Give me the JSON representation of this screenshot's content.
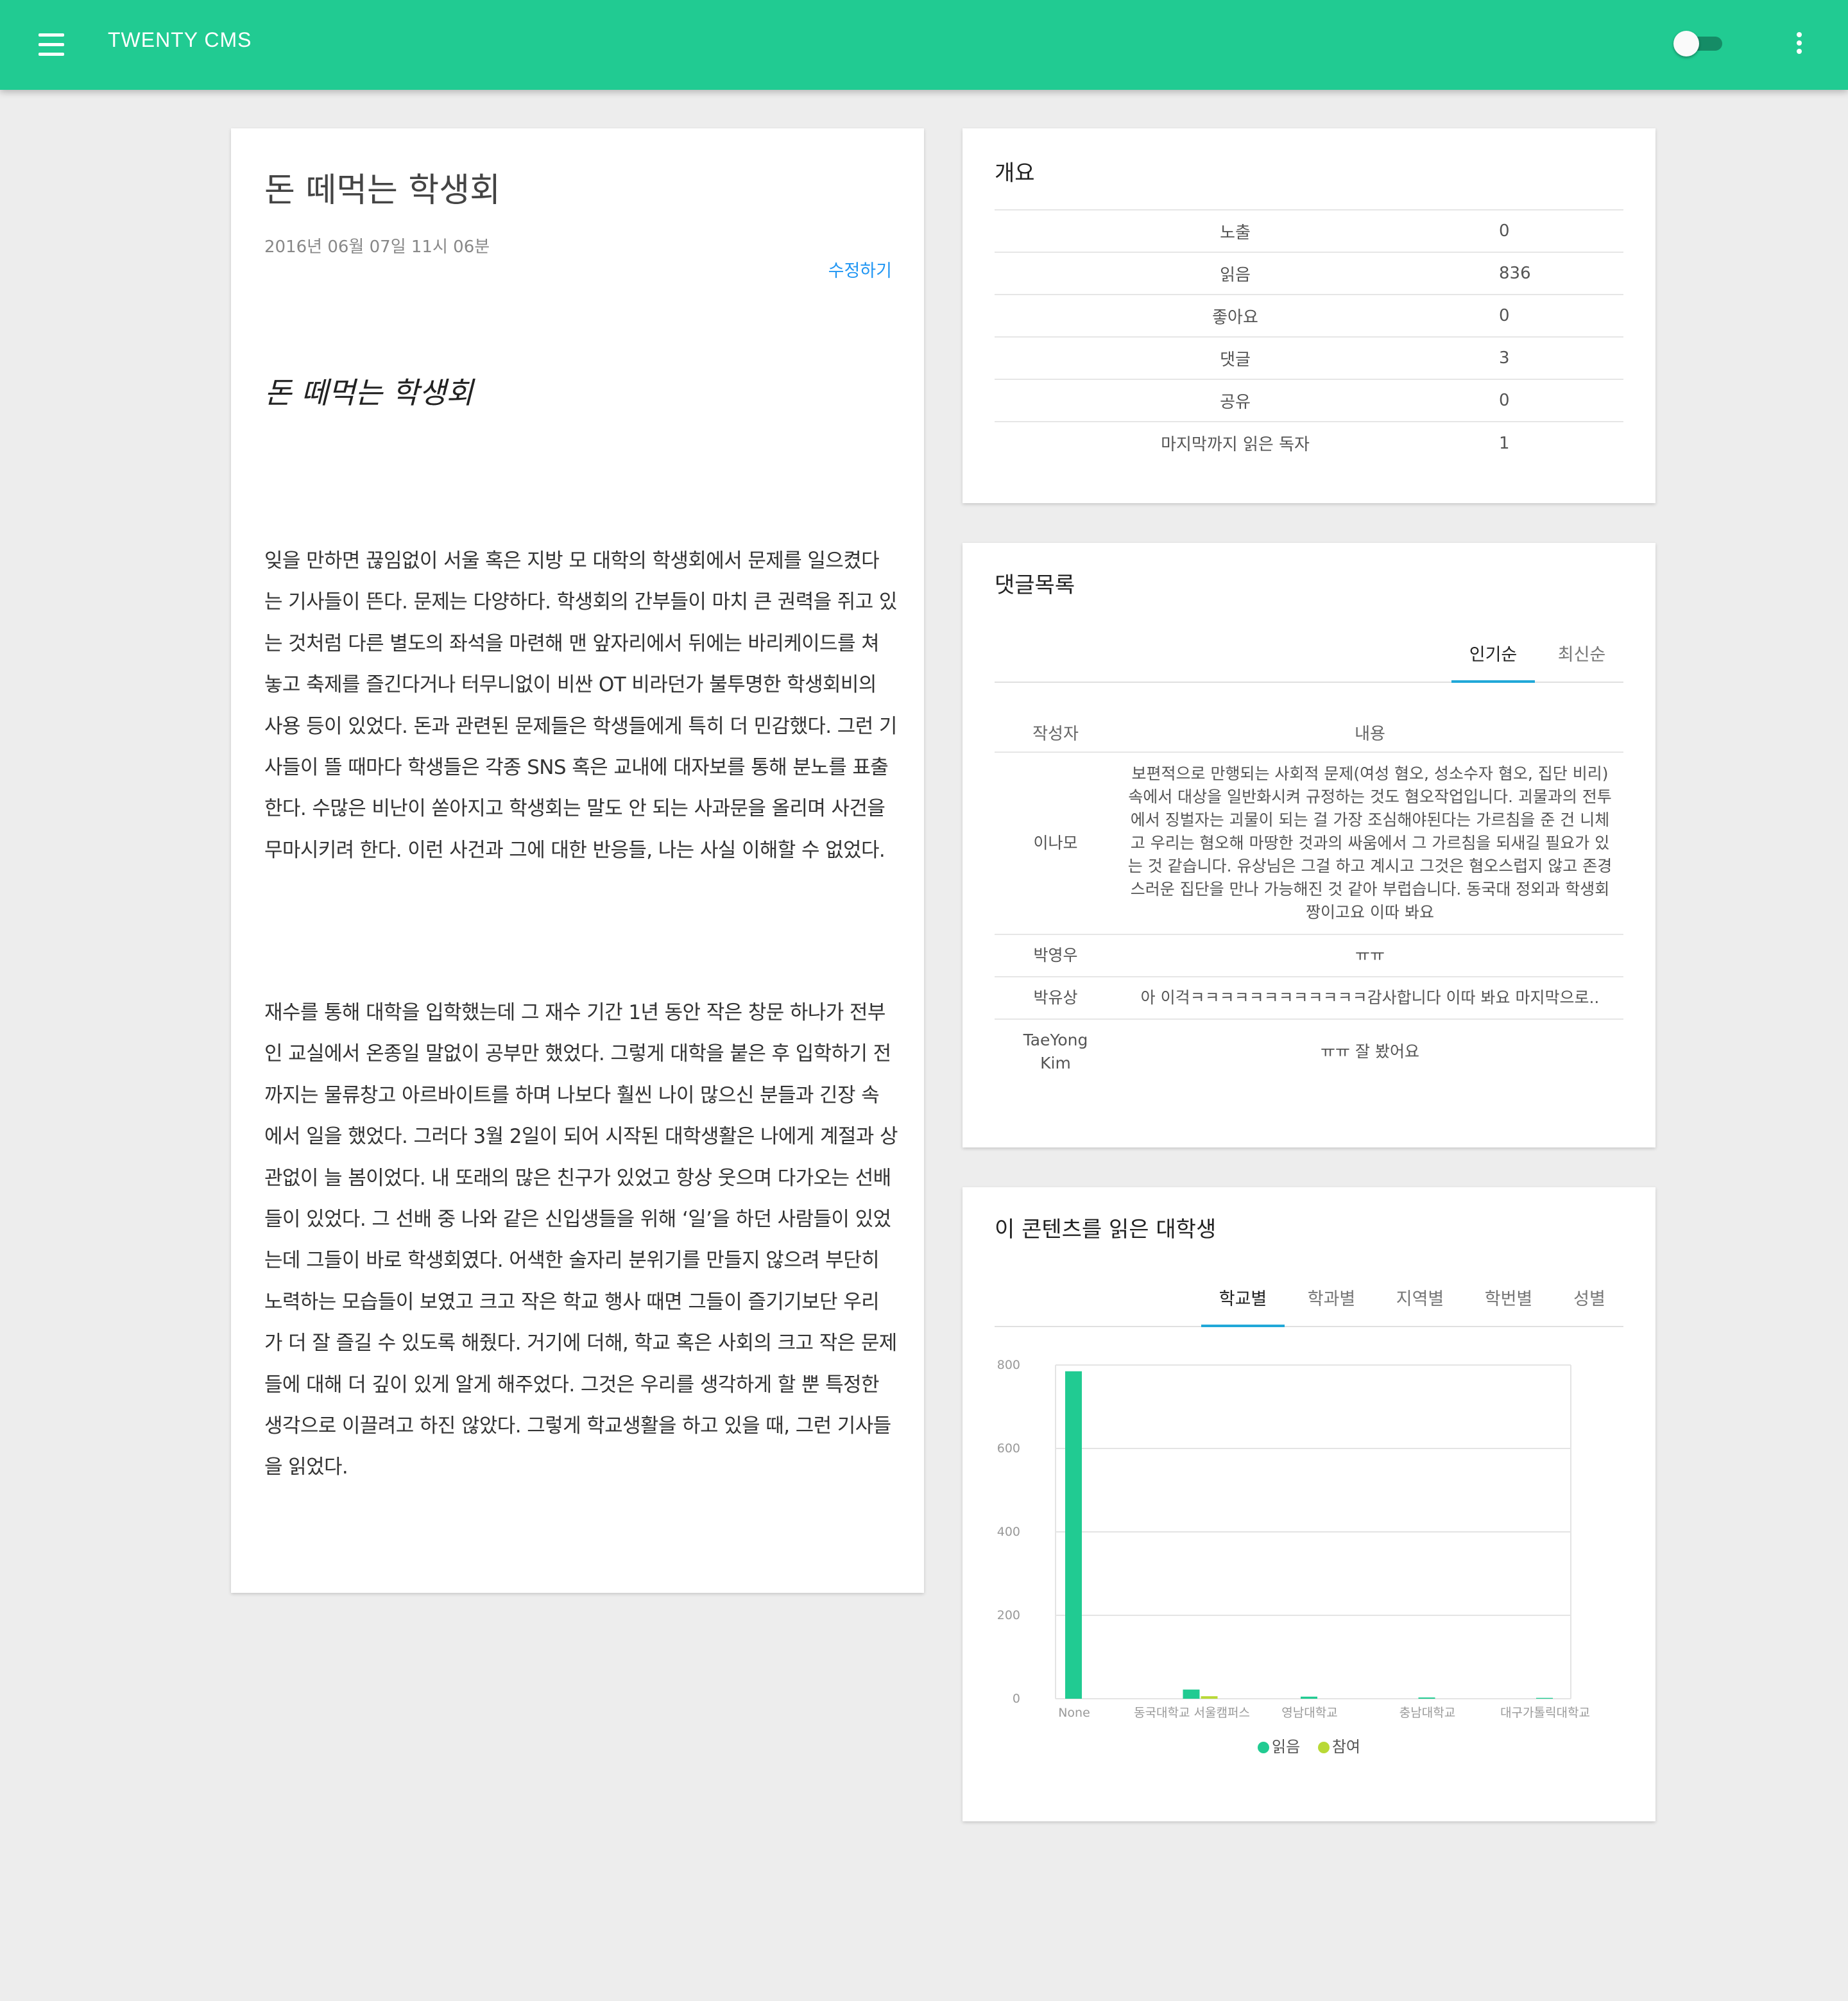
{
  "appbar": {
    "title": "TWENTY CMS",
    "menu_icon": "hamburger-menu-icon",
    "toggle_state": "off",
    "more_icon": "more-vertical-icon"
  },
  "article": {
    "title": "돈 떼먹는 학생회",
    "date": "2016년 06월 07일 11시 06분",
    "edit_label": "수정하기",
    "heading": "돈 떼먹는 학생회",
    "paragraphs": [
      [
        "잊을 만하면 끊임없이 서울 혹은 지방 모 대학의 학생회에서 문제를 일으켰다",
        "는 기사들이 뜬다. 문제는 다양하다. 학생회의 간부들이 마치 큰 권력을 쥐고 있",
        "는 것처럼 다른 별도의 좌석을 마련해 맨 앞자리에서 뒤에는 바리케이드를 쳐",
        "놓고 축제를 즐긴다거나 터무니없이 비싼 OT 비라던가 불투명한 학생회비의",
        "사용 등이 있었다. 돈과 관련된 문제들은 학생들에게 특히 더 민감했다. 그런 기",
        "사들이 뜰 때마다 학생들은 각종 SNS 혹은 교내에 대자보를 통해 분노를 표출",
        "한다. 수많은 비난이 쏟아지고 학생회는 말도 안 되는 사과문을 올리며 사건을",
        "무마시키려 한다. 이런 사건과 그에 대한 반응들, 나는 사실 이해할 수 없었다."
      ],
      [
        "재수를 통해 대학을 입학했는데 그 재수 기간 1년 동안 작은 창문 하나가 전부",
        "인 교실에서 온종일 말없이 공부만 했었다. 그렇게 대학을 붙은 후 입학하기 전",
        "까지는 물류창고 아르바이트를 하며 나보다 훨씬 나이 많으신 분들과 긴장 속",
        "에서 일을 했었다. 그러다 3월 2일이 되어 시작된 대학생활은 나에게 계절과 상",
        "관없이 늘 봄이었다. 내 또래의 많은 친구가 있었고 항상 웃으며 다가오는 선배",
        "들이 있었다. 그 선배 중 나와 같은 신입생들을 위해 ‘일’을 하던 사람들이 있었",
        "는데 그들이 바로 학생회였다. 어색한 술자리 분위기를 만들지 않으려 부단히",
        "노력하는 모습들이 보였고 크고 작은 학교 행사 때면 그들이 즐기기보단 우리",
        "가 더 잘 즐길 수 있도록 해줬다. 거기에 더해, 학교 혹은 사회의 크고 작은 문제",
        "들에 대해 더 깊이 있게 알게 해주었다. 그것은 우리를 생각하게 할 뿐 특정한",
        "생각으로 이끌려고 하진 않았다. 그렇게 학교생활을 하고 있을 때, 그런 기사들",
        "을 읽었다."
      ]
    ]
  },
  "overview": {
    "title": "개요",
    "rows": [
      {
        "label": "노출",
        "value": "0"
      },
      {
        "label": "읽음",
        "value": "836"
      },
      {
        "label": "좋아요",
        "value": "0"
      },
      {
        "label": "댓글",
        "value": "3"
      },
      {
        "label": "공유",
        "value": "0"
      },
      {
        "label": "마지막까지 읽은 독자",
        "value": "1"
      }
    ]
  },
  "comments": {
    "title": "댓글목록",
    "tabs": [
      "인기순",
      "최신순"
    ],
    "active_tab": 0,
    "headers": {
      "author": "작성자",
      "content": "내용"
    },
    "rows": [
      {
        "author": "이나모",
        "content": "보편적으로 만행되는 사회적 문제(여성 혐오, 성소수자 혐오, 집단 비리) 속에서 대상을 일반화시켜 규정하는 것도 혐오작업입니다. 괴물과의 전투에서 징벌자는 괴물이 되는 걸 가장 조심해야된다는 가르침을 준 건 니체고 우리는 혐오해 마땅한 것과의 싸움에서 그 가르침을 되새길 필요가 있는 것 같습니다. 유상님은 그걸 하고 계시고 그것은 혐오스럽지 않고 존경스러운 집단을 만나 가능해진 것 같아 부럽습니다. 동국대 정외과 학생회 짱이고요 이따 봐요"
      },
      {
        "author": "박영우",
        "content": "ㅠㅠ"
      },
      {
        "author": "박유상",
        "content": "아 이걱ㅋㅋㅋㅋㅋㅋㅋㅋㅋㅋㅋㅋ감사합니다 이따 봐요 마지막으로.."
      },
      {
        "author": "TaeYong Kim",
        "content": "ㅠㅠ 잘 봤어요"
      }
    ]
  },
  "readers": {
    "title": "이 콘텐츠를 읽은 대학생",
    "tabs": [
      "학교별",
      "학과별",
      "지역별",
      "학번별",
      "성별"
    ],
    "active_tab": 0
  },
  "colors": {
    "accent": "#21cb92",
    "tab_underline": "#21a8d8",
    "link": "#2196f3",
    "series_read": "#21cb92",
    "series_participate": "#b9d936"
  },
  "chart_data": {
    "type": "bar",
    "categories": [
      "None",
      "동국대학교 서울캠퍼스",
      "영남대학교",
      "충남대학교",
      "대구가톨릭대학교"
    ],
    "series": [
      {
        "name": "읽음",
        "values": [
          785,
          22,
          5,
          3,
          2
        ]
      },
      {
        "name": "참여",
        "values": [
          0,
          6,
          0,
          0,
          0
        ]
      }
    ],
    "ylim": [
      0,
      800
    ],
    "yticks": [
      0,
      200,
      400,
      600,
      800
    ],
    "grid": true,
    "legend": "bottom-center"
  }
}
